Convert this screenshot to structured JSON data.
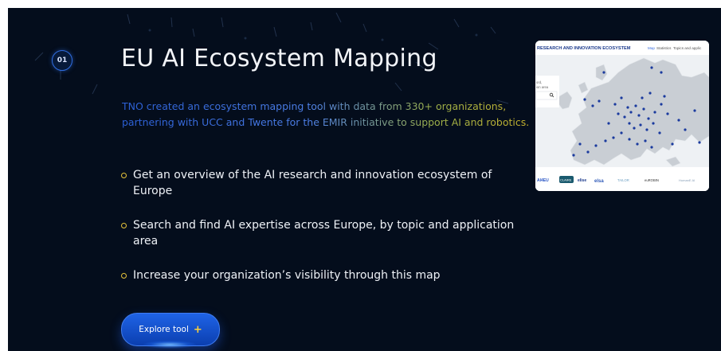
{
  "feature": {
    "step_number": "01",
    "title": "EU AI Ecosystem Mapping",
    "intro": "TNO created an ecosystem mapping tool with data from 330+ organizations, partnering with UCC and Twente for the EMIR initiative to support AI and robotics.",
    "bullets": [
      "Get an overview of the AI research and innovation ecosystem of Europe",
      "Search and find AI expertise across Europe, by topic and application area",
      "Increase your organization’s visibility through this map"
    ],
    "cta_label": "Explore tool",
    "cta_icon": "plus-icon"
  },
  "preview": {
    "header": "RESEARCH AND INNOVATION ECOSYSTEM",
    "nav": [
      "Map",
      "Statistics",
      "Topics and applic"
    ],
    "search_hint_line1": "ord,",
    "search_hint_line2": "ion area",
    "partner_logos": [
      "AI4EU",
      "CLAIRE",
      "elise",
      "elsa",
      "TAILOR",
      "euROBIN",
      "HumanE AI"
    ]
  },
  "colors": {
    "background": "#040d1c",
    "accent_blue": "#1f63e6",
    "accent_yellow": "#e6c43a",
    "map_dot": "#1a3a9e"
  }
}
